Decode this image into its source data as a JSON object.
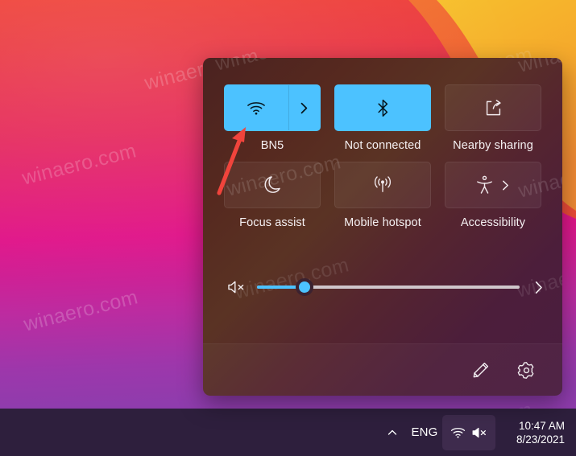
{
  "desktop": {
    "wallpaper_colors": {
      "red": "#ef4239",
      "orange": "#f5932b",
      "yellow": "#f7bb2c",
      "magenta": "#e0168a",
      "purple": "#8f3cad"
    },
    "watermark_text": "winaero.com"
  },
  "taskbar": {
    "background": "#2e1f3d",
    "show_hidden_icons": {
      "icon": "chevron-up-icon",
      "label": ""
    },
    "language": "ENG",
    "tray_icons": [
      {
        "icon": "wifi-icon",
        "name": "network-tray-icon"
      },
      {
        "icon": "speaker-muted-icon",
        "name": "volume-tray-icon"
      }
    ],
    "clock": {
      "time": "10:47 AM",
      "date": "8/23/2021"
    }
  },
  "quick_settings": {
    "accent_color": "#4cc2ff",
    "tiles": [
      {
        "name": "wifi",
        "label": "BN5",
        "icon": "wifi-icon",
        "state": "on",
        "has_chevron": true,
        "split": true
      },
      {
        "name": "bluetooth",
        "label": "Not connected",
        "icon": "bluetooth-icon",
        "state": "on",
        "has_chevron": false,
        "split": false
      },
      {
        "name": "nearby-sharing",
        "label": "Nearby sharing",
        "icon": "share-icon",
        "state": "off",
        "has_chevron": false,
        "split": false
      },
      {
        "name": "focus-assist",
        "label": "Focus assist",
        "icon": "moon-icon",
        "state": "off",
        "has_chevron": false,
        "split": false
      },
      {
        "name": "mobile-hotspot",
        "label": "Mobile hotspot",
        "icon": "hotspot-icon",
        "state": "off",
        "has_chevron": false,
        "split": false
      },
      {
        "name": "accessibility",
        "label": "Accessibility",
        "icon": "accessibility-icon",
        "state": "off",
        "has_chevron": true,
        "split": false
      }
    ],
    "volume": {
      "icon": "speaker-muted-icon",
      "value": 18,
      "min": 0,
      "max": 100,
      "expand_icon": "chevron-right-icon"
    },
    "footer": {
      "edit_icon": "pencil-icon",
      "settings_icon": "gear-icon"
    }
  },
  "annotation": {
    "arrow_color": "#f0443c",
    "points_at": "wifi-tile"
  }
}
